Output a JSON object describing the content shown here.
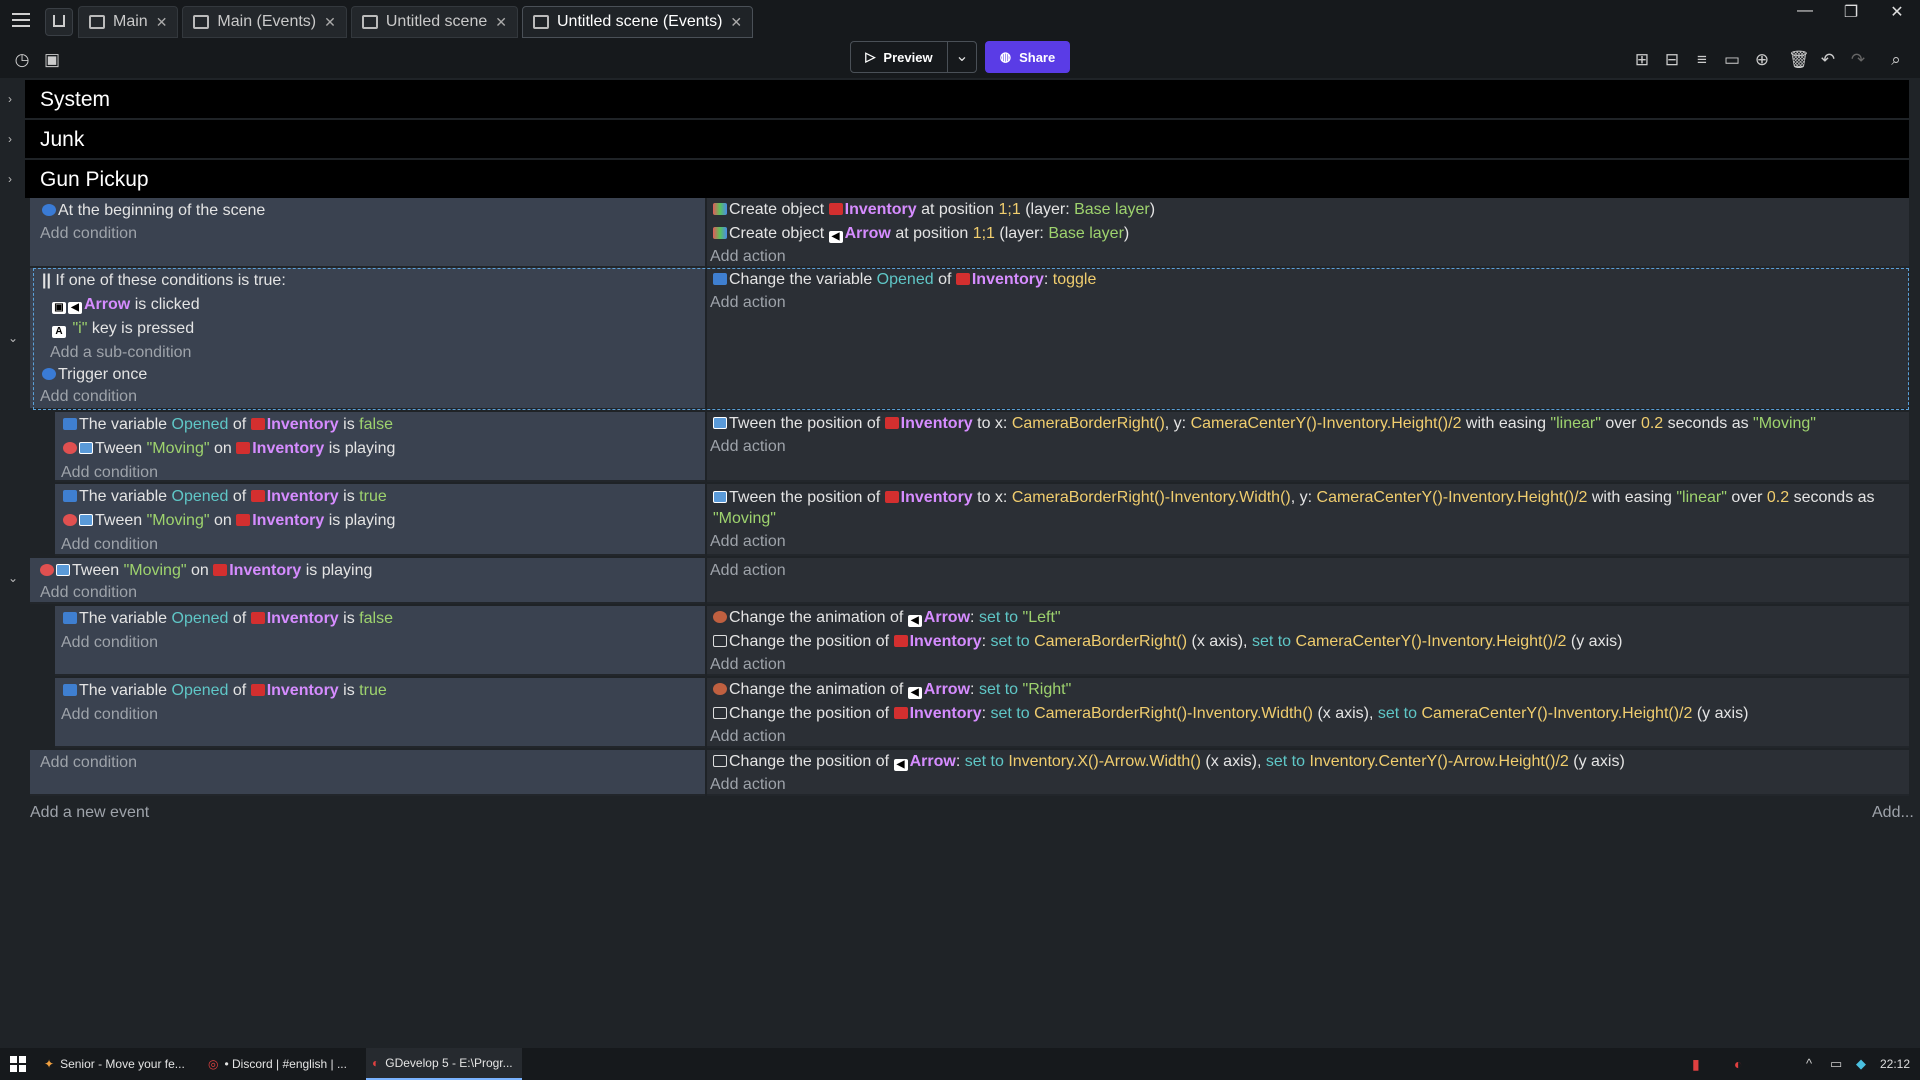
{
  "tabs": [
    {
      "label": "Main",
      "active": false
    },
    {
      "label": "Main (Events)",
      "active": false
    },
    {
      "label": "Untitled scene",
      "active": false
    },
    {
      "label": "Untitled scene (Events)",
      "active": true
    }
  ],
  "toolbar": {
    "preview_label": "Preview",
    "share_label": "Share"
  },
  "groups": [
    "System",
    "Junk",
    "Gun Pickup"
  ],
  "event1": {
    "cond": "At the beginning of the scene",
    "add_condition": "Add condition",
    "act1": {
      "prefix": "Create object",
      "obj": "Inventory",
      "mid": "at position",
      "pos": "1;1",
      "layer_pre": "(layer:",
      "layer": "Base layer",
      "layer_post": ")"
    },
    "act2": {
      "prefix": "Create object",
      "obj": "Arrow",
      "mid": "at position",
      "pos": "1;1",
      "layer_pre": "(layer:",
      "layer": "Base layer",
      "layer_post": ")"
    },
    "add_action": "Add action"
  },
  "event2": {
    "or_label": "If one of these conditions is true:",
    "sub1_obj": "Arrow",
    "sub1_txt": "is clicked",
    "sub2_key": "\"i\"",
    "sub2_txt": "key is pressed",
    "add_sub": "Add a sub-condition",
    "trigger": "Trigger once",
    "add_condition": "Add condition",
    "act": {
      "prefix": "Change the variable",
      "var": "Opened",
      "of": "of",
      "obj": "Inventory",
      "colon": ":",
      "value": "toggle"
    },
    "add_action": "Add action"
  },
  "event3": {
    "c1": {
      "prefix": "The variable",
      "var": "Opened",
      "of": "of",
      "obj": "Inventory",
      "is": "is",
      "value": "false"
    },
    "c2": {
      "prefix": "Tween",
      "name": "\"Moving\"",
      "on": "on",
      "obj": "Inventory",
      "suffix": "is playing"
    },
    "add_condition": "Add condition",
    "act": {
      "prefix": "Tween the position of",
      "obj": "Inventory",
      "x_pre": "to x:",
      "x": "CameraBorderRight()",
      "y_pre": ", y:",
      "y": "CameraCenterY()-Inventory.Height()/2",
      "ease_pre": "with easing",
      "ease": "\"linear\"",
      "over": "over",
      "dur": "0.2",
      "sec": "seconds as",
      "id": "\"Moving\""
    },
    "add_action": "Add action"
  },
  "event4": {
    "c1": {
      "prefix": "The variable",
      "var": "Opened",
      "of": "of",
      "obj": "Inventory",
      "is": "is",
      "value": "true"
    },
    "c2": {
      "prefix": "Tween",
      "name": "\"Moving\"",
      "on": "on",
      "obj": "Inventory",
      "suffix": "is playing"
    },
    "add_condition": "Add condition",
    "act": {
      "prefix": "Tween the position of",
      "obj": "Inventory",
      "x_pre": "to x:",
      "x": "CameraBorderRight()-Inventory.Width()",
      "y_pre": ", y:",
      "y": "CameraCenterY()-Inventory.Height()/2",
      "ease_pre": "with easing",
      "ease": "\"linear\"",
      "over": "over",
      "dur": "0.2",
      "sec": "seconds as",
      "id": "\"Moving\""
    },
    "add_action": "Add action"
  },
  "event5": {
    "c1": {
      "prefix": "Tween",
      "name": "\"Moving\"",
      "on": "on",
      "obj": "Inventory",
      "suffix": "is playing"
    },
    "add_condition": "Add condition",
    "add_action": "Add action"
  },
  "event6": {
    "c1": {
      "prefix": "The variable",
      "var": "Opened",
      "of": "of",
      "obj": "Inventory",
      "is": "is",
      "value": "false"
    },
    "add_condition": "Add condition",
    "a1": {
      "prefix": "Change the animation of",
      "obj": "Arrow",
      "colon": ":",
      "set": "set to",
      "value": "\"Left\""
    },
    "a2": {
      "prefix": "Change the position of",
      "obj": "Inventory",
      "colon": ":",
      "set": "set to",
      "x": "CameraBorderRight()",
      "xa": "(x axis),",
      "set2": "set to",
      "y": "CameraCenterY()-Inventory.Height()/2",
      "ya": "(y axis)"
    },
    "add_action": "Add action"
  },
  "event7": {
    "c1": {
      "prefix": "The variable",
      "var": "Opened",
      "of": "of",
      "obj": "Inventory",
      "is": "is",
      "value": "true"
    },
    "add_condition": "Add condition",
    "a1": {
      "prefix": "Change the animation of",
      "obj": "Arrow",
      "colon": ":",
      "set": "set to",
      "value": "\"Right\""
    },
    "a2": {
      "prefix": "Change the position of",
      "obj": "Inventory",
      "colon": ":",
      "set": "set to",
      "x": "CameraBorderRight()-Inventory.Width()",
      "xa": "(x axis),",
      "set2": "set to",
      "y": "CameraCenterY()-Inventory.Height()/2",
      "ya": "(y axis)"
    },
    "add_action": "Add action"
  },
  "event8": {
    "add_condition": "Add condition",
    "a1": {
      "prefix": "Change the position of",
      "obj": "Arrow",
      "colon": ":",
      "set": "set to",
      "x": "Inventory.X()-Arrow.Width()",
      "xa": "(x axis),",
      "set2": "set to",
      "y": "Inventory.CenterY()-Arrow.Height()/2",
      "ya": "(y axis)"
    },
    "add_action": "Add action"
  },
  "footer": {
    "add_event": "Add a new event",
    "add_more": "Add..."
  },
  "taskbar": {
    "items": [
      "Senior - Move your fe...",
      "• Discord | #english | ...",
      "GDevelop 5 - E:\\Progr..."
    ],
    "clock": "22:12"
  }
}
